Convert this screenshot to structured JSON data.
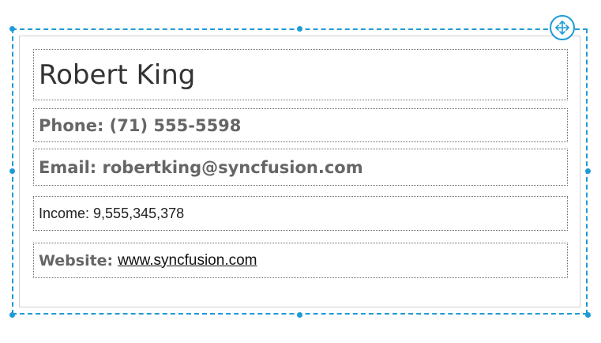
{
  "card": {
    "name": "Robert King",
    "phone": "Phone: (71) 555-5598",
    "email": "Email: robertking@syncfusion.com",
    "income": "Income: 9,555,345,378",
    "website_label": "Website:",
    "website_link": "www.syncfusion.com"
  },
  "colors": {
    "selection": "#1e9bd7",
    "field_text": "#666666",
    "name_text": "#333333"
  },
  "icons": {
    "move_handle": "move-arrows-icon"
  }
}
